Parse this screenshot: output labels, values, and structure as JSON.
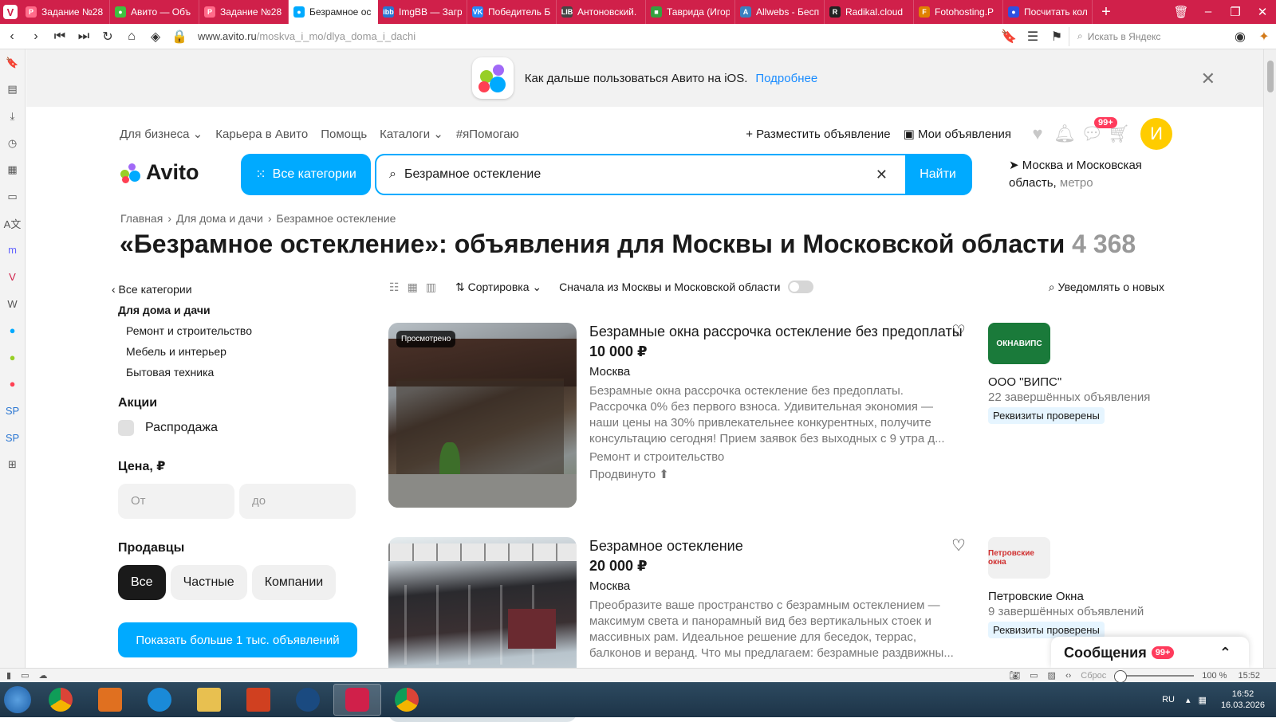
{
  "browser": {
    "tabs": [
      {
        "label": "Задание №28",
        "color": "#ff6b8a",
        "glyph": "P"
      },
      {
        "label": "Авито — Объ",
        "color": "#40c040",
        "glyph": "●"
      },
      {
        "label": "Задание №28",
        "color": "#ff6b8a",
        "glyph": "P"
      },
      {
        "label": "Безрамное ос",
        "color": "#00aaff",
        "glyph": "●"
      },
      {
        "label": "ImgBB — Загр",
        "color": "#2a76d2",
        "glyph": "ibb"
      },
      {
        "label": "Победитель Б",
        "color": "#2787f5",
        "glyph": "VK"
      },
      {
        "label": "Антоновский.",
        "color": "#444",
        "glyph": "LIB"
      },
      {
        "label": "Таврида (Игор",
        "color": "#35a040",
        "glyph": "■"
      },
      {
        "label": "Allwebs - Бесп",
        "color": "#3a80c0",
        "glyph": "A"
      },
      {
        "label": "Radikal.cloud",
        "color": "#222",
        "glyph": "R"
      },
      {
        "label": "Fotohosting.P",
        "color": "#e08000",
        "glyph": "F"
      },
      {
        "label": "Посчитать кол",
        "color": "#3050e0",
        "glyph": "●"
      }
    ],
    "url_host": "www.avito.ru",
    "url_path": "/moskva_i_mo/dlya_doma_i_dachi",
    "search_placeholder": "Искать в Яндекс",
    "status": {
      "reset": "Сброс",
      "zoom": "100 %",
      "time": "15:52"
    }
  },
  "banner": {
    "text": "Как дальше пользоваться Авито на iOS.",
    "link": "Подробнее",
    "close": "✕"
  },
  "nav": {
    "left": [
      "Для бизнеса ⌄",
      "Карьера в Авито",
      "Помощь",
      "Каталоги ⌄",
      "#яПомогаю"
    ],
    "post": "+ Разместить объявление",
    "my": "Мои объявления",
    "chat_badge": "99+",
    "avatar_letter": "И"
  },
  "header": {
    "logo_text": "Avito",
    "all_categories": "Все категории",
    "query": "Безрамное остекление",
    "find": "Найти",
    "region": "Москва и Московская область,",
    "metro": "метро"
  },
  "crumbs": [
    "Главная",
    "›",
    "Для дома и дачи",
    "›",
    "Безрамное остекление"
  ],
  "title": "«Безрамное остекление»: объявления для Москвы и Московской области",
  "count": "4 368",
  "sidebar": {
    "all": "‹ Все категории",
    "category": "Для дома и дачи",
    "subcats": [
      "Ремонт и строительство",
      "Мебель и интерьер",
      "Бытовая техника"
    ],
    "promo_title": "Акции",
    "sale": "Распродажа",
    "price_title": "Цена, ₽",
    "price_from": "От",
    "price_to": "до",
    "sellers_title": "Продавцы",
    "sellers": [
      "Все",
      "Частные",
      "Компании"
    ],
    "show_more": "Показать больше 1 тыс. объявлений"
  },
  "toolbar": {
    "sort": "⇅ Сортировка ⌄",
    "moscow_first": "Сначала из Москвы и Московской области",
    "notify": "Уведомлять о новых"
  },
  "listings": [
    {
      "seen": "Просмотрено",
      "title": "Безрамные окна рассрочка остекление без предоплаты",
      "price": "10 000 ₽",
      "location": "Москва",
      "desc": "Безрамные окна рассрочка остекление без предоплаты. Рассрочка 0% без первого взноса. Удивительная экономия — наши цены на 30% привлекательнее конкурентных, получите консультацию сегодня! Прием заявок без выходных с 9 утра д...",
      "category": "Ремонт и строительство",
      "promoted": "Продвинуто ⬆",
      "seller": {
        "logo": "ОКНАВИПС",
        "logo_bg": "#1a7a3a",
        "logo_fg": "#ffffff",
        "name": "ООО \"ВИПС\"",
        "rating": "22 завершённых объявления",
        "verified": "Реквизиты проверены"
      }
    },
    {
      "seen": "",
      "title": "Безрамное остекление",
      "price": "20 000 ₽",
      "location": "Москва",
      "desc": "Преобразите ваше пространство с безрамным остеклением — максимум света и панорамный вид без вертикальных стоек и массивных рам. Идеальное решение для беседок, террас, балконов и веранд. Что мы предлагаем: безрамные раздвижны...",
      "category": "",
      "promoted": "",
      "seller": {
        "logo": "Петровские окна",
        "logo_bg": "#f0f0f0",
        "logo_fg": "#d03030",
        "name": "Петровские Окна",
        "rating": "9 завершённых объявлений",
        "verified": "Реквизиты проверены"
      }
    }
  ],
  "messages": {
    "label": "Сообщения",
    "badge": "99+"
  },
  "taskbar": {
    "lang": "RU",
    "time": "16:52",
    "date": "16.03.2026"
  }
}
